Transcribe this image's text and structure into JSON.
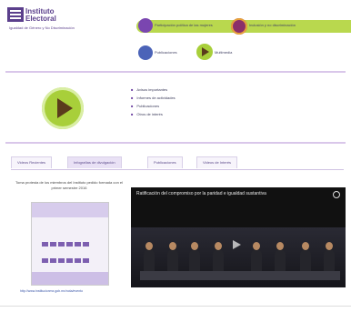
{
  "header": {
    "logo_name_line1": "Instituto",
    "logo_name_line2": "Electoral",
    "logo_tagline": "Igualdad de Género y No Discriminación"
  },
  "nav": {
    "link1": "Participación política de las mujeres",
    "link2": "Inclusión y no discriminación",
    "link3": "Publicaciones",
    "link4": "Multimedia"
  },
  "bullets": [
    "Avisos importantes",
    "Informes de actividades",
    "Publicaciones",
    "Otros de interés"
  ],
  "tabs": [
    "Videos Recientes",
    "Infografías de divulgación",
    "Publicaciones",
    "Videos de Interés"
  ],
  "poster": {
    "caption": "Toma protesta de los miembros del Instituto pedido formada con el primer semestre 2016",
    "link": "http://www.institucionmx.gob.mx/nota/evento"
  },
  "video": {
    "title": "Ratificación del compromiso por la paridad e igualdad sustantiva"
  },
  "colors": {
    "accent_green": "#b9d84e",
    "accent_purple": "#6b3fa0"
  }
}
